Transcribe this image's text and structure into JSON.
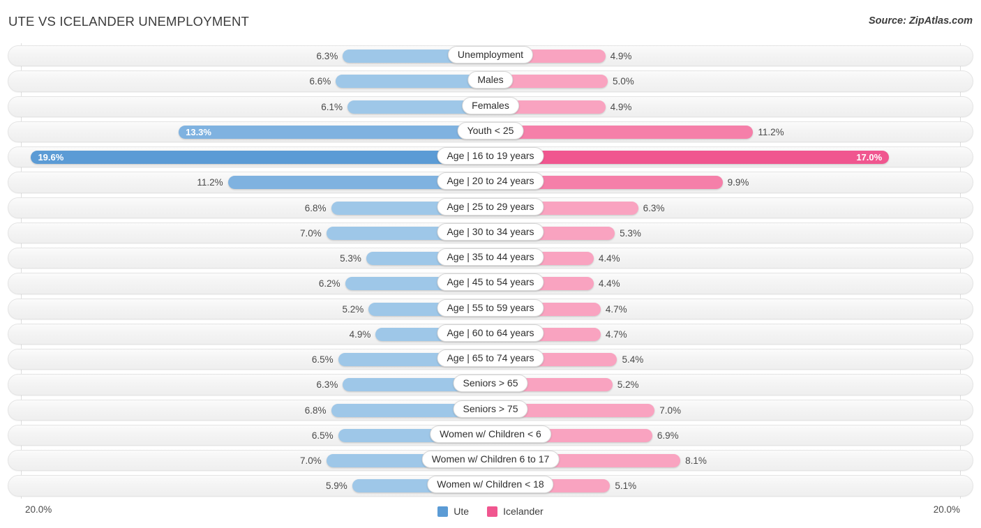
{
  "header": {
    "title": "UTE VS ICELANDER UNEMPLOYMENT",
    "source": "Source: ZipAtlas.com"
  },
  "axis": {
    "left_max_label": "20.0%",
    "right_max_label": "20.0%",
    "max_value": 20.0
  },
  "legend": {
    "items": [
      {
        "label": "Ute",
        "color": "#5b9bd5"
      },
      {
        "label": "Icelander",
        "color": "#f0568f"
      }
    ]
  },
  "colors": {
    "ute_light": "#9ec7e8",
    "ute_mid": "#7fb2e0",
    "ute_strong": "#5b9bd5",
    "icelander_light": "#f9a3c0",
    "icelander_mid": "#f57fa9",
    "icelander_strong": "#f0568f",
    "track": "#f4f4f4",
    "gridline": "#dedede",
    "text": "#4a4a4a"
  },
  "chart_data": {
    "type": "bar",
    "title": "UTE VS ICELANDER UNEMPLOYMENT",
    "subtitle": "",
    "orientation": "horizontal-diverging",
    "xlabel": "",
    "ylabel": "",
    "xlim": [
      20.0,
      20.0
    ],
    "grid": true,
    "legend_position": "bottom-center",
    "categories": [
      "Unemployment",
      "Males",
      "Females",
      "Youth < 25",
      "Age | 16 to 19 years",
      "Age | 20 to 24 years",
      "Age | 25 to 29 years",
      "Age | 30 to 34 years",
      "Age | 35 to 44 years",
      "Age | 45 to 54 years",
      "Age | 55 to 59 years",
      "Age | 60 to 64 years",
      "Age | 65 to 74 years",
      "Seniors > 65",
      "Seniors > 75",
      "Women w/ Children < 6",
      "Women w/ Children 6 to 17",
      "Women w/ Children < 18"
    ],
    "series": [
      {
        "name": "Ute",
        "color": "#5b9bd5",
        "side": "left",
        "values": [
          6.3,
          6.6,
          6.1,
          13.3,
          19.6,
          11.2,
          6.8,
          7.0,
          5.3,
          6.2,
          5.2,
          4.9,
          6.5,
          6.3,
          6.8,
          6.5,
          7.0,
          5.9
        ],
        "labels": [
          "6.3%",
          "6.6%",
          "6.1%",
          "13.3%",
          "19.6%",
          "11.2%",
          "6.8%",
          "7.0%",
          "5.3%",
          "6.2%",
          "5.2%",
          "4.9%",
          "6.5%",
          "6.3%",
          "6.8%",
          "6.5%",
          "7.0%",
          "5.9%"
        ]
      },
      {
        "name": "Icelander",
        "color": "#f0568f",
        "side": "right",
        "values": [
          4.9,
          5.0,
          4.9,
          11.2,
          17.0,
          9.9,
          6.3,
          5.3,
          4.4,
          4.4,
          4.7,
          4.7,
          5.4,
          5.2,
          7.0,
          6.9,
          8.1,
          5.1
        ],
        "labels": [
          "4.9%",
          "5.0%",
          "4.9%",
          "11.2%",
          "17.0%",
          "9.9%",
          "6.3%",
          "5.3%",
          "4.4%",
          "4.4%",
          "4.7%",
          "4.7%",
          "5.4%",
          "5.2%",
          "7.0%",
          "6.9%",
          "8.1%",
          "5.1%"
        ]
      }
    ]
  },
  "rows": [
    {
      "label": "Unemployment",
      "left_value": 6.3,
      "left_label": "6.3%",
      "right_value": 4.9,
      "right_label": "4.9%",
      "left_inside": false,
      "right_inside": false,
      "left_color": "#9ec7e8",
      "right_color": "#f9a3c0"
    },
    {
      "label": "Males",
      "left_value": 6.6,
      "left_label": "6.6%",
      "right_value": 5.0,
      "right_label": "5.0%",
      "left_inside": false,
      "right_inside": false,
      "left_color": "#9ec7e8",
      "right_color": "#f9a3c0"
    },
    {
      "label": "Females",
      "left_value": 6.1,
      "left_label": "6.1%",
      "right_value": 4.9,
      "right_label": "4.9%",
      "left_inside": false,
      "right_inside": false,
      "left_color": "#9ec7e8",
      "right_color": "#f9a3c0"
    },
    {
      "label": "Youth < 25",
      "left_value": 13.3,
      "left_label": "13.3%",
      "right_value": 11.2,
      "right_label": "11.2%",
      "left_inside": true,
      "right_inside": false,
      "left_color": "#7fb2e0",
      "right_color": "#f57fa9"
    },
    {
      "label": "Age | 16 to 19 years",
      "left_value": 19.6,
      "left_label": "19.6%",
      "right_value": 17.0,
      "right_label": "17.0%",
      "left_inside": true,
      "right_inside": true,
      "left_color": "#5b9bd5",
      "right_color": "#f0568f"
    },
    {
      "label": "Age | 20 to 24 years",
      "left_value": 11.2,
      "left_label": "11.2%",
      "right_value": 9.9,
      "right_label": "9.9%",
      "left_inside": false,
      "right_inside": false,
      "left_color": "#7fb2e0",
      "right_color": "#f57fa9"
    },
    {
      "label": "Age | 25 to 29 years",
      "left_value": 6.8,
      "left_label": "6.8%",
      "right_value": 6.3,
      "right_label": "6.3%",
      "left_inside": false,
      "right_inside": false,
      "left_color": "#9ec7e8",
      "right_color": "#f9a3c0"
    },
    {
      "label": "Age | 30 to 34 years",
      "left_value": 7.0,
      "left_label": "7.0%",
      "right_value": 5.3,
      "right_label": "5.3%",
      "left_inside": false,
      "right_inside": false,
      "left_color": "#9ec7e8",
      "right_color": "#f9a3c0"
    },
    {
      "label": "Age | 35 to 44 years",
      "left_value": 5.3,
      "left_label": "5.3%",
      "right_value": 4.4,
      "right_label": "4.4%",
      "left_inside": false,
      "right_inside": false,
      "left_color": "#9ec7e8",
      "right_color": "#f9a3c0"
    },
    {
      "label": "Age | 45 to 54 years",
      "left_value": 6.2,
      "left_label": "6.2%",
      "right_value": 4.4,
      "right_label": "4.4%",
      "left_inside": false,
      "right_inside": false,
      "left_color": "#9ec7e8",
      "right_color": "#f9a3c0"
    },
    {
      "label": "Age | 55 to 59 years",
      "left_value": 5.2,
      "left_label": "5.2%",
      "right_value": 4.7,
      "right_label": "4.7%",
      "left_inside": false,
      "right_inside": false,
      "left_color": "#9ec7e8",
      "right_color": "#f9a3c0"
    },
    {
      "label": "Age | 60 to 64 years",
      "left_value": 4.9,
      "left_label": "4.9%",
      "right_value": 4.7,
      "right_label": "4.7%",
      "left_inside": false,
      "right_inside": false,
      "left_color": "#9ec7e8",
      "right_color": "#f9a3c0"
    },
    {
      "label": "Age | 65 to 74 years",
      "left_value": 6.5,
      "left_label": "6.5%",
      "right_value": 5.4,
      "right_label": "5.4%",
      "left_inside": false,
      "right_inside": false,
      "left_color": "#9ec7e8",
      "right_color": "#f9a3c0"
    },
    {
      "label": "Seniors > 65",
      "left_value": 6.3,
      "left_label": "6.3%",
      "right_value": 5.2,
      "right_label": "5.2%",
      "left_inside": false,
      "right_inside": false,
      "left_color": "#9ec7e8",
      "right_color": "#f9a3c0"
    },
    {
      "label": "Seniors > 75",
      "left_value": 6.8,
      "left_label": "6.8%",
      "right_value": 7.0,
      "right_label": "7.0%",
      "left_inside": false,
      "right_inside": false,
      "left_color": "#9ec7e8",
      "right_color": "#f9a3c0"
    },
    {
      "label": "Women w/ Children < 6",
      "left_value": 6.5,
      "left_label": "6.5%",
      "right_value": 6.9,
      "right_label": "6.9%",
      "left_inside": false,
      "right_inside": false,
      "left_color": "#9ec7e8",
      "right_color": "#f9a3c0"
    },
    {
      "label": "Women w/ Children 6 to 17",
      "left_value": 7.0,
      "left_label": "7.0%",
      "right_value": 8.1,
      "right_label": "8.1%",
      "left_inside": false,
      "right_inside": false,
      "left_color": "#9ec7e8",
      "right_color": "#f9a3c0"
    },
    {
      "label": "Women w/ Children < 18",
      "left_value": 5.9,
      "left_label": "5.9%",
      "right_value": 5.1,
      "right_label": "5.1%",
      "left_inside": false,
      "right_inside": false,
      "left_color": "#9ec7e8",
      "right_color": "#f9a3c0"
    }
  ]
}
